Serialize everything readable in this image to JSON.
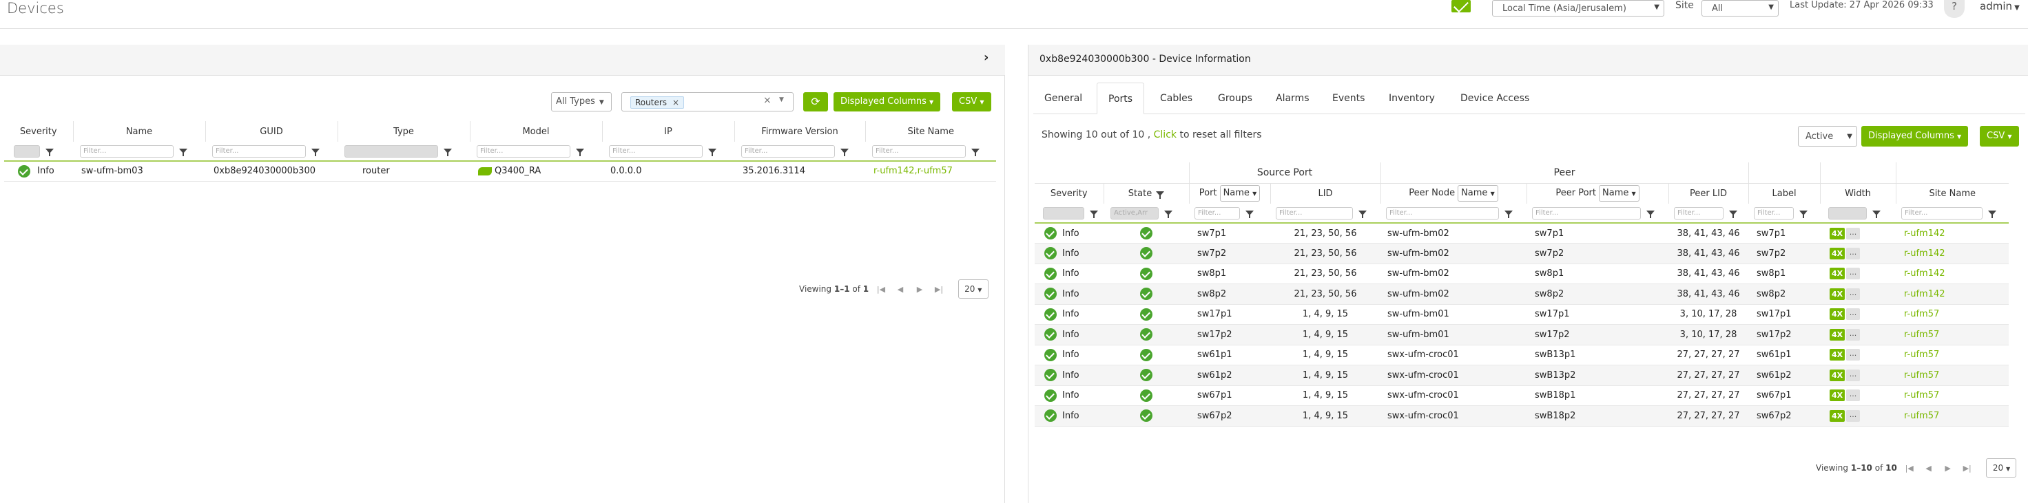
{
  "header": {
    "title": "Devices",
    "timezone": "Local Time (Asia/Jerusalem)",
    "site_label": "Site",
    "site_value": "All",
    "last_update": "Last Update: 27 Apr 2026 09:33",
    "help": "?",
    "user": "admin"
  },
  "left": {
    "type_filter": "All Types",
    "tag": "Routers",
    "tag_remove": "×",
    "clear": "×",
    "displayed_columns": "Displayed Columns",
    "csv": "CSV",
    "columns": [
      "Severity",
      "Name",
      "GUID",
      "Type",
      "Model",
      "IP",
      "Firmware Version",
      "Site Name"
    ],
    "filter_placeholder": "Filter...",
    "rows": [
      {
        "severity": "Info",
        "name": "sw-ufm-bm03",
        "guid": "0xb8e924030000b300",
        "type": "router",
        "model": "Q3400_RA",
        "ip": "0.0.0.0",
        "firmware": "35.2016.3114",
        "site": "r-ufm142,r-ufm57"
      }
    ],
    "pager": {
      "viewing_prefix": "Viewing ",
      "range": "1–1",
      "of_label": " of ",
      "total": "1",
      "page_size": "20"
    }
  },
  "right": {
    "title": "0xb8e924030000b300 - Device Information",
    "tabs": [
      "General",
      "Ports",
      "Cables",
      "Groups",
      "Alarms",
      "Events",
      "Inventory",
      "Device Access"
    ],
    "active_tab": "Ports",
    "showing_prefix": "Showing 10 out of 10 , ",
    "click": "Click",
    "showing_suffix": " to reset all filters",
    "active_filter": "Active",
    "displayed_columns": "Displayed Columns",
    "csv": "CSV",
    "groups": {
      "source": "Source Port",
      "peer": "Peer"
    },
    "columns": {
      "severity": "Severity",
      "state": "State",
      "port": "Port",
      "port_sel": "Name",
      "lid": "LID",
      "peer_node": "Peer Node",
      "peer_node_sel": "Name",
      "peer_port": "Peer Port",
      "peer_port_sel": "Name",
      "peer_lid": "Peer LID",
      "label": "Label",
      "width": "Width",
      "site": "Site Name"
    },
    "filter_placeholder": "Filter...",
    "state_filter": "Active,Arr",
    "rows": [
      {
        "severity": "Info",
        "port": "sw7p1",
        "lid": "21, 23, 50, 56",
        "peer_node": "sw-ufm-bm02",
        "peer_port": "sw7p1",
        "peer_lid": "38, 41, 43, 46",
        "label": "sw7p1",
        "width": "4X",
        "site": "r-ufm142"
      },
      {
        "severity": "Info",
        "port": "sw7p2",
        "lid": "21, 23, 50, 56",
        "peer_node": "sw-ufm-bm02",
        "peer_port": "sw7p2",
        "peer_lid": "38, 41, 43, 46",
        "label": "sw7p2",
        "width": "4X",
        "site": "r-ufm142"
      },
      {
        "severity": "Info",
        "port": "sw8p1",
        "lid": "21, 23, 50, 56",
        "peer_node": "sw-ufm-bm02",
        "peer_port": "sw8p1",
        "peer_lid": "38, 41, 43, 46",
        "label": "sw8p1",
        "width": "4X",
        "site": "r-ufm142"
      },
      {
        "severity": "Info",
        "port": "sw8p2",
        "lid": "21, 23, 50, 56",
        "peer_node": "sw-ufm-bm02",
        "peer_port": "sw8p2",
        "peer_lid": "38, 41, 43, 46",
        "label": "sw8p2",
        "width": "4X",
        "site": "r-ufm142"
      },
      {
        "severity": "Info",
        "port": "sw17p1",
        "lid": "1, 4, 9, 15",
        "peer_node": "sw-ufm-bm01",
        "peer_port": "sw17p1",
        "peer_lid": "3, 10, 17, 28",
        "label": "sw17p1",
        "width": "4X",
        "site": "r-ufm57"
      },
      {
        "severity": "Info",
        "port": "sw17p2",
        "lid": "1, 4, 9, 15",
        "peer_node": "sw-ufm-bm01",
        "peer_port": "sw17p2",
        "peer_lid": "3, 10, 17, 28",
        "label": "sw17p2",
        "width": "4X",
        "site": "r-ufm57"
      },
      {
        "severity": "Info",
        "port": "sw61p1",
        "lid": "1, 4, 9, 15",
        "peer_node": "swx-ufm-croc01",
        "peer_port": "swB13p1",
        "peer_lid": "27, 27, 27, 27",
        "label": "sw61p1",
        "width": "4X",
        "site": "r-ufm57"
      },
      {
        "severity": "Info",
        "port": "sw61p2",
        "lid": "1, 4, 9, 15",
        "peer_node": "swx-ufm-croc01",
        "peer_port": "swB13p2",
        "peer_lid": "27, 27, 27, 27",
        "label": "sw61p2",
        "width": "4X",
        "site": "r-ufm57"
      },
      {
        "severity": "Info",
        "port": "sw67p1",
        "lid": "1, 4, 9, 15",
        "peer_node": "swx-ufm-croc01",
        "peer_port": "swB18p1",
        "peer_lid": "27, 27, 27, 27",
        "label": "sw67p1",
        "width": "4X",
        "site": "r-ufm57"
      },
      {
        "severity": "Info",
        "port": "sw67p2",
        "lid": "1, 4, 9, 15",
        "peer_node": "swx-ufm-croc01",
        "peer_port": "swB18p2",
        "peer_lid": "27, 27, 27, 27",
        "label": "sw67p2",
        "width": "4X",
        "site": "r-ufm57"
      }
    ],
    "more": "...",
    "pager": {
      "viewing_prefix": "Viewing ",
      "range": "1–10",
      "of_label": " of ",
      "total": "10",
      "page_size": "20"
    }
  },
  "colors": {
    "accent": "#76b900",
    "ok": "#4aa52e",
    "link": "#7ab800"
  }
}
